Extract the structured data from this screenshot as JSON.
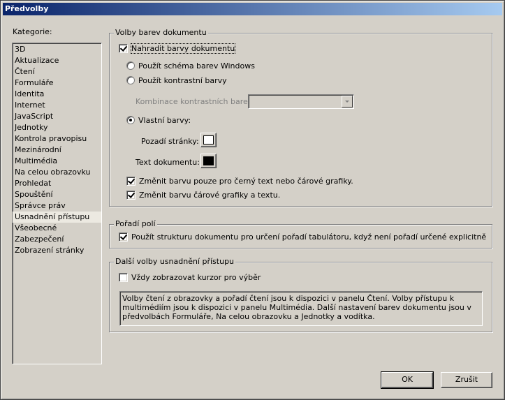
{
  "window": {
    "title": "Předvolby"
  },
  "categories": {
    "label": "Kategorie:",
    "selected": "Usnadnění přístupu",
    "items": [
      "3D",
      "Aktualizace",
      "Čtení",
      "Formuláře",
      "Identita",
      "Internet",
      "JavaScript",
      "Jednotky",
      "Kontrola pravopisu",
      "Mezinárodní",
      "Multimédia",
      "Na celou obrazovku",
      "Prohledat",
      "Spouštění",
      "Správce práv",
      "Usnadnění přístupu",
      "Všeobecné",
      "Zabezpečení",
      "Zobrazení stránky"
    ]
  },
  "doc_colors": {
    "title": "Volby barev dokumentu",
    "replace_colors": {
      "label": "Nahradit barvy dokumentu",
      "checked": true
    },
    "use_windows_scheme": {
      "label": "Použít schéma barev Windows",
      "selected": false
    },
    "use_high_contrast": {
      "label": "Použít kontrastní barvy",
      "selected": false
    },
    "contrast_combo": {
      "label": "Kombinace kontrastních barev:",
      "value": "",
      "enabled": false
    },
    "custom_colors": {
      "label": "Vlastní barvy:",
      "selected": true
    },
    "page_background": {
      "label": "Pozadí stránky:",
      "color": "#ffffff"
    },
    "document_text": {
      "label": "Text dokumentu:",
      "color": "#000000"
    },
    "change_black_text_only": {
      "label": "Změnit barvu pouze pro černý text nebo čárové grafiky.",
      "checked": true
    },
    "change_line_art": {
      "label": "Změnit barvu čárové grafiky a textu.",
      "checked": true
    }
  },
  "tab_order": {
    "title": "Pořadí polí",
    "use_structure": {
      "label": "Použít strukturu dokumentu pro určení pořadí tabulátoru, když není pořadí určené explicitně",
      "checked": true
    }
  },
  "other_options": {
    "title": "Další volby usnadnění přístupu",
    "always_show_cursor": {
      "label": "Vždy zobrazovat kurzor pro výběr",
      "checked": false
    },
    "info_text": "Volby čtení z obrazovky a pořadí čtení jsou k dispozici v panelu Čtení. Volby přístupu k multimédiím jsou k dispozici v panelu Multimédia. Další nastavení barev dokumentu jsou v předvolbách Formuláře, Na celou obrazovku a Jednotky a vodítka."
  },
  "buttons": {
    "ok": "OK",
    "cancel": "Zrušit"
  }
}
